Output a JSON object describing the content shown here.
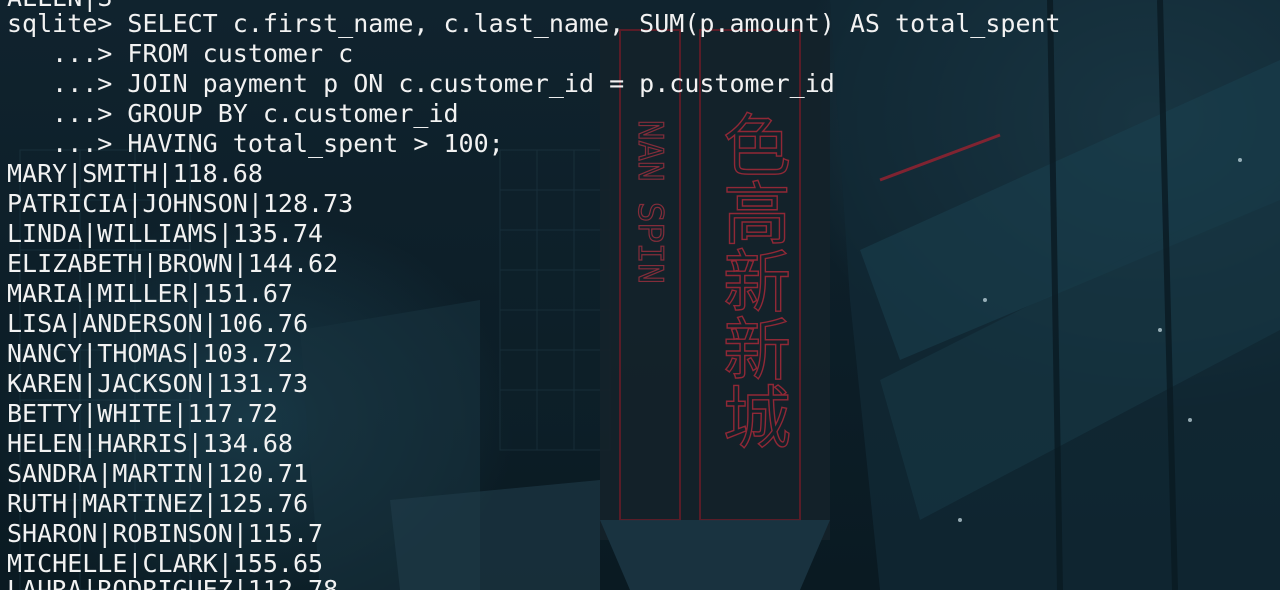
{
  "terminal": {
    "top_partial_line": "ALLEN|S",
    "prompt": "sqlite> ",
    "continuation_prompt": "   ...> ",
    "query_lines": [
      "SELECT c.first_name, c.last_name, SUM(p.amount) AS total_spent",
      "FROM customer c",
      "JOIN payment p ON c.customer_id = p.customer_id",
      "GROUP BY c.customer_id",
      "HAVING total_spent > 100;"
    ],
    "result_rows": [
      "MARY|SMITH|118.68",
      "PATRICIA|JOHNSON|128.73",
      "LINDA|WILLIAMS|135.74",
      "ELIZABETH|BROWN|144.62",
      "MARIA|MILLER|151.67",
      "LISA|ANDERSON|106.76",
      "NANCY|THOMAS|103.72",
      "KAREN|JACKSON|131.73",
      "BETTY|WHITE|117.72",
      "HELEN|HARRIS|134.68",
      "SANDRA|MARTIN|120.71",
      "RUTH|MARTINEZ|125.76",
      "SHARON|ROBINSON|115.7",
      "MICHELLE|CLARK|155.65",
      "LAURA|RODRIGUEZ|112.78"
    ]
  },
  "wallpaper": {
    "sign_vertical_text": "NAN SPIN",
    "sign_glyphs": "色高新新城",
    "accent_color": "#c0283a",
    "text_color": "#f2f2f2"
  }
}
